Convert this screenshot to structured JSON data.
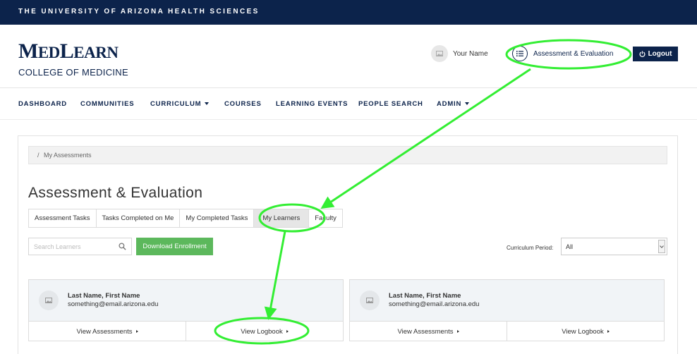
{
  "topbar": {
    "title": "THE UNIVERSITY OF ARIZONA HEALTH SCIENCES"
  },
  "logo": {
    "main_first": "M",
    "main_rest1": "ED",
    "main_mid": "L",
    "main_rest2": "EARN",
    "sub": "COLLEGE OF MEDICINE"
  },
  "header": {
    "user_name": "Your Name",
    "assessment_link": "Assessment & Evaluation",
    "logout_label": "Logout"
  },
  "nav": {
    "items": [
      {
        "label": "DASHBOARD",
        "dropdown": false
      },
      {
        "label": "COMMUNITIES",
        "dropdown": false
      },
      {
        "label": "CURRICULUM",
        "dropdown": true
      },
      {
        "label": "COURSES",
        "dropdown": false
      },
      {
        "label": "LEARNING EVENTS",
        "dropdown": false
      },
      {
        "label": "PEOPLE SEARCH",
        "dropdown": false
      },
      {
        "label": "ADMIN",
        "dropdown": true
      }
    ]
  },
  "breadcrumb": {
    "separator": "/",
    "current": "My Assessments"
  },
  "page": {
    "title": "Assessment & Evaluation"
  },
  "tabs": [
    {
      "label": "Assessment Tasks",
      "active": false
    },
    {
      "label": "Tasks Completed on Me",
      "active": false
    },
    {
      "label": "My Completed Tasks",
      "active": false
    },
    {
      "label": "My Learners",
      "active": true
    },
    {
      "label": "Faculty",
      "active": false
    }
  ],
  "toolbar": {
    "search_placeholder": "Search Learners",
    "download_label": "Download Enrollment",
    "period_label": "Curriculum Period:",
    "period_value": "All"
  },
  "learners": [
    {
      "name": "Last Name, First Name",
      "email": "something@email.arizona.edu",
      "view_assessments": "View Assessments",
      "view_logbook": "View Logbook"
    },
    {
      "name": "Last Name, First Name",
      "email": "something@email.arizona.edu",
      "view_assessments": "View Assessments",
      "view_logbook": "View Logbook"
    }
  ],
  "colors": {
    "brand_navy": "#0c234b",
    "download_green": "#5cb85c",
    "annotation_green": "#33ee33"
  },
  "icons": [
    "image-placeholder-icon",
    "list-icon",
    "power-icon",
    "search-icon",
    "chevron-down-icon",
    "caret-right-icon"
  ]
}
